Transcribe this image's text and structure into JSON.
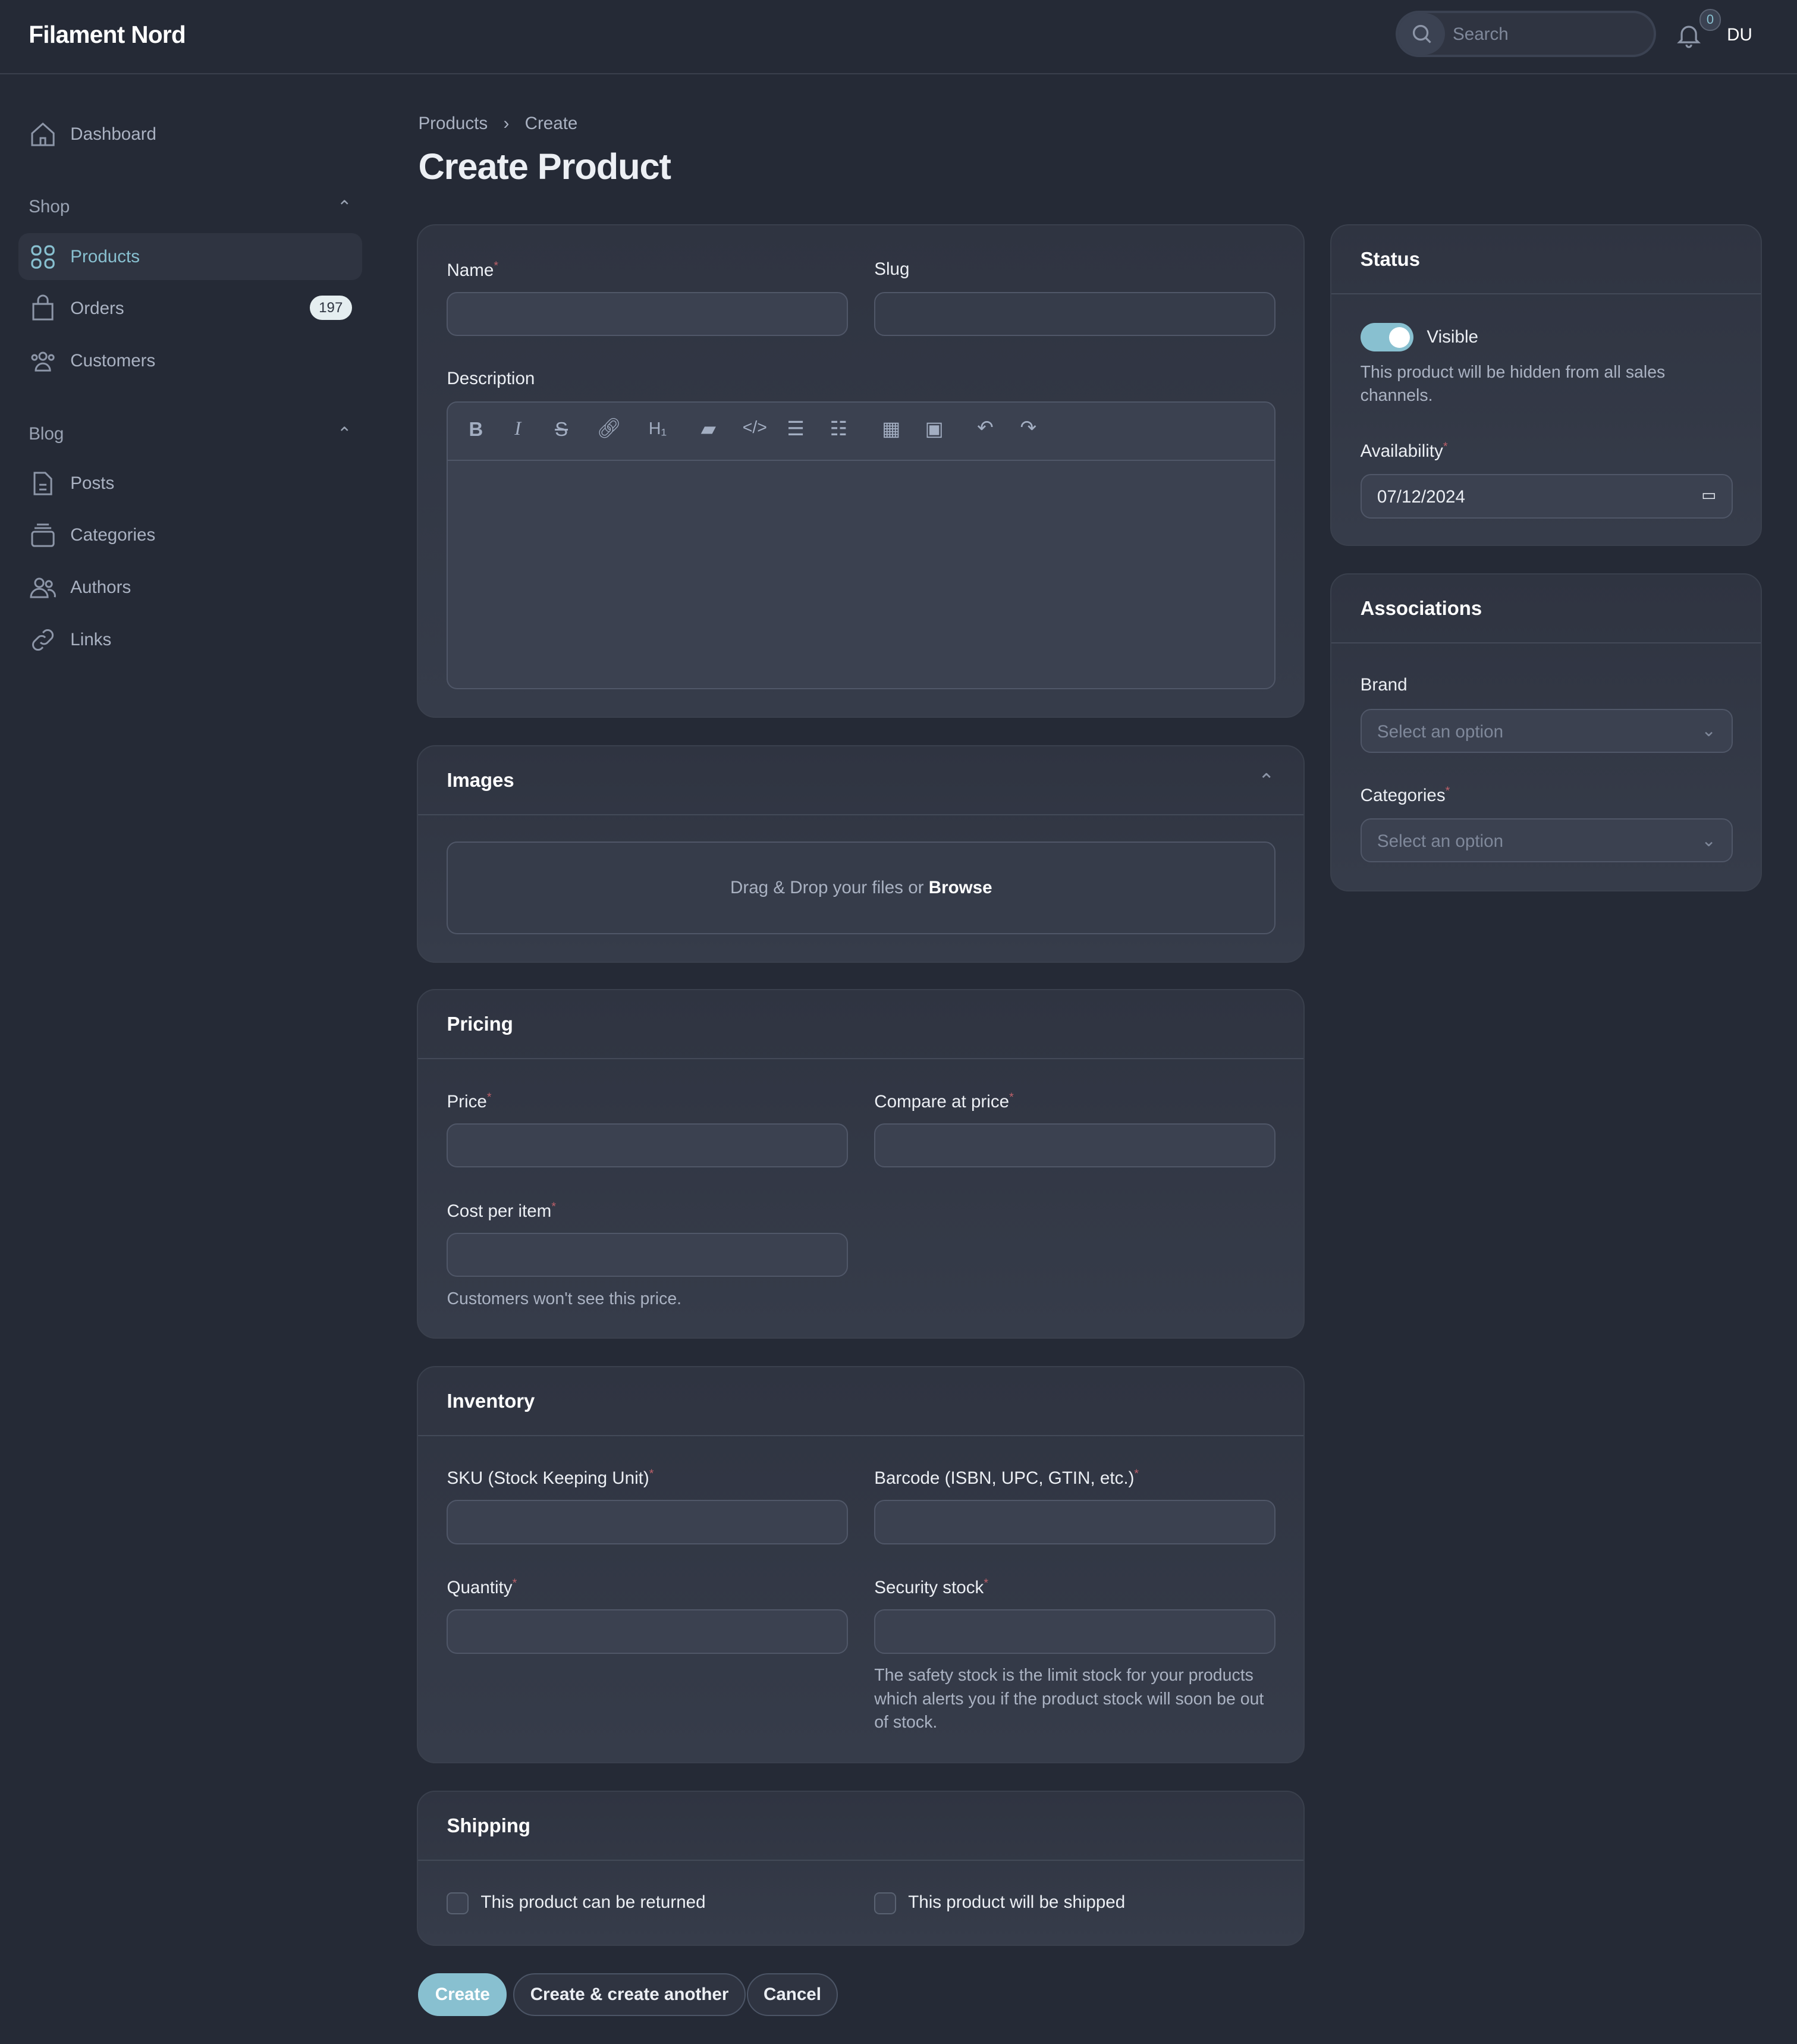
{
  "app": {
    "title": "Filament Nord",
    "search_placeholder": "Search",
    "notifications_count": "0",
    "user_initials": "DU"
  },
  "sidebar": {
    "dashboard": "Dashboard",
    "groups": [
      {
        "label": "Shop",
        "items": [
          {
            "label": "Products",
            "active": true
          },
          {
            "label": "Orders",
            "badge": "197"
          },
          {
            "label": "Customers"
          }
        ]
      },
      {
        "label": "Blog",
        "items": [
          {
            "label": "Posts"
          },
          {
            "label": "Categories"
          },
          {
            "label": "Authors"
          },
          {
            "label": "Links"
          }
        ]
      }
    ]
  },
  "breadcrumb": [
    "Products",
    "Create"
  ],
  "page_title": "Create Product",
  "main": {
    "name_label": "Name",
    "slug_label": "Slug",
    "description_label": "Description",
    "images": {
      "title": "Images",
      "drop_text": "Drag & Drop your files or ",
      "browse": "Browse"
    },
    "pricing": {
      "title": "Pricing",
      "price": "Price",
      "compare": "Compare at price",
      "cost": "Cost per item",
      "cost_help": "Customers won't see this price."
    },
    "inventory": {
      "title": "Inventory",
      "sku": "SKU (Stock Keeping Unit)",
      "barcode": "Barcode (ISBN, UPC, GTIN, etc.)",
      "quantity": "Quantity",
      "security": "Security stock",
      "security_help": "The safety stock is the limit stock for your products which alerts you if the product stock will soon be out of stock."
    },
    "shipping": {
      "title": "Shipping",
      "returnable": "This product can be returned",
      "shipped": "This product will be shipped"
    }
  },
  "status": {
    "title": "Status",
    "visible_label": "Visible",
    "visible_on": true,
    "visible_help": "This product will be hidden from all sales channels.",
    "availability_label": "Availability",
    "availability_value": "07/12/2024"
  },
  "associations": {
    "title": "Associations",
    "brand_label": "Brand",
    "brand_placeholder": "Select an option",
    "categories_label": "Categories",
    "categories_placeholder": "Select an option"
  },
  "actions": {
    "create": "Create",
    "create_another": "Create & create another",
    "cancel": "Cancel"
  },
  "colors": {
    "accent": "#88c0d0",
    "background": "#252a36",
    "required": "#bf616a"
  }
}
